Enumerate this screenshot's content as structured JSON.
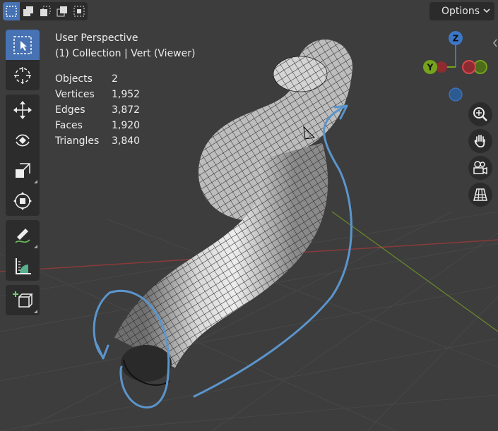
{
  "header": {
    "select_modes": [
      "select-new-icon",
      "select-extend-icon",
      "select-subtract-icon",
      "select-invert-icon",
      "select-intersect-icon"
    ],
    "options_label": "Options"
  },
  "toolbar": {
    "tools": [
      "select-box",
      "cursor",
      "move",
      "rotate",
      "scale",
      "transform",
      "annotate",
      "measure",
      "add-cube"
    ],
    "active_tool": "select-box"
  },
  "viewport": {
    "view_name": "User Perspective",
    "collection_line": "(1) Collection | Vert (Viewer)",
    "stats": [
      {
        "label": "Objects",
        "value": "2"
      },
      {
        "label": "Vertices",
        "value": "1,952"
      },
      {
        "label": "Edges",
        "value": "3,872"
      },
      {
        "label": "Faces",
        "value": "1,920"
      },
      {
        "label": "Triangles",
        "value": "3,840"
      }
    ]
  },
  "gizmo": {
    "z_label": "Z",
    "y_label": "Y",
    "x_color": "#d9464f",
    "y_color": "#75a31b",
    "z_color": "#3c77c7"
  },
  "navigation": [
    "zoom-icon",
    "pan-hand-icon",
    "camera-icon",
    "ortho-grid-icon"
  ],
  "colors": {
    "background": "#3d3d3d",
    "selection": "#4772b3",
    "annotation": "#5b95cc",
    "grid_x_axis": "#8a3a3a",
    "grid_y_axis": "#6a8a2a"
  }
}
